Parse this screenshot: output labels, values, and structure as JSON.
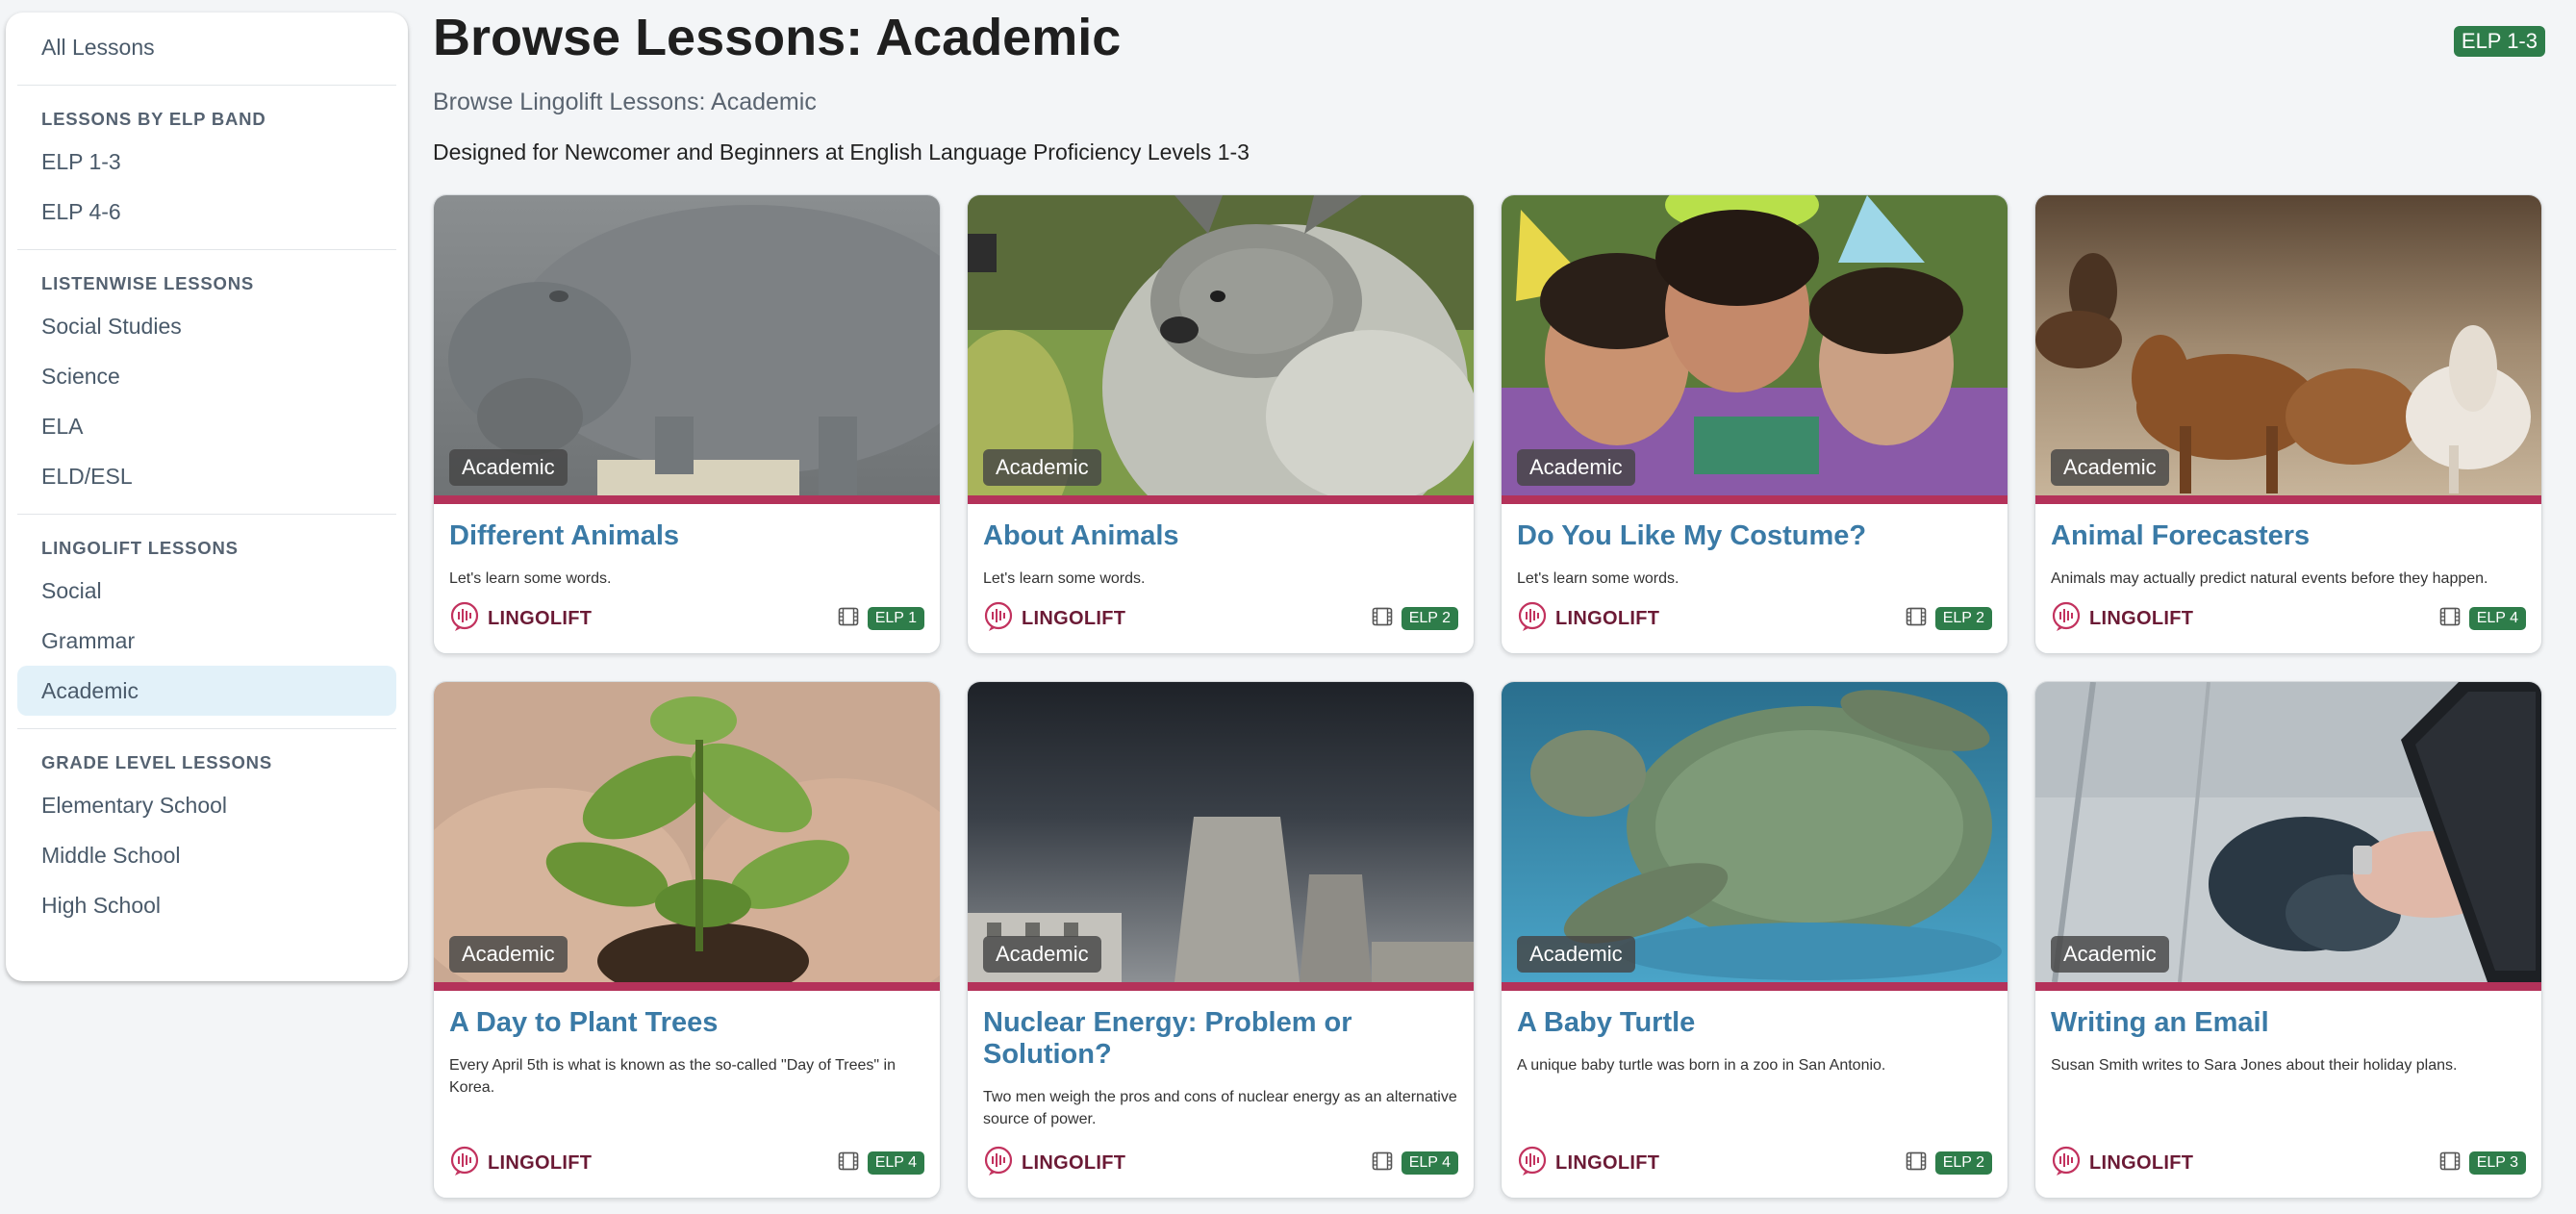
{
  "sidebar": {
    "all_lessons": "All Lessons",
    "sections": [
      {
        "heading": "LESSONS BY ELP BAND",
        "items": [
          "ELP 1-3",
          "ELP 4-6"
        ]
      },
      {
        "heading": "LISTENWISE LESSONS",
        "items": [
          "Social Studies",
          "Science",
          "ELA",
          "ELD/ESL"
        ]
      },
      {
        "heading": "LINGOLIFT LESSONS",
        "items": [
          "Social",
          "Grammar",
          "Academic"
        ]
      },
      {
        "heading": "GRADE LEVEL LESSONS",
        "items": [
          "Elementary School",
          "Middle School",
          "High School"
        ]
      }
    ],
    "active_item": "Academic"
  },
  "header": {
    "title": "Browse Lessons: Academic",
    "elp_badge": "ELP 1-3",
    "subtitle": "Browse Lingolift Lessons: Academic",
    "description": "Designed for Newcomer and Beginners at English Language Proficiency Levels 1-3"
  },
  "colors": {
    "accent_bar": "#b4325a",
    "title_link": "#3a7aa6",
    "elp_green": "#2e7d4a",
    "brand": "#6b1a35",
    "active_sidebar": "#e2f1f9"
  },
  "cards": [
    {
      "category": "Academic",
      "title": "Different Animals",
      "text": "Let's learn some words.",
      "brand": "LINGOLIFT",
      "elp": "ELP 1",
      "image": "hippo"
    },
    {
      "category": "Academic",
      "title": "About Animals",
      "text": "Let's learn some words.",
      "brand": "LINGOLIFT",
      "elp": "ELP 2",
      "image": "kangaroo"
    },
    {
      "category": "Academic",
      "title": "Do You Like My Costume?",
      "text": "Let's learn some words.",
      "brand": "LINGOLIFT",
      "elp": "ELP 2",
      "image": "party-kids"
    },
    {
      "category": "Academic",
      "title": "Animal Forecasters",
      "text": "Animals may actually predict natural events before they happen.",
      "brand": "LINGOLIFT",
      "elp": "ELP 4",
      "image": "horses"
    },
    {
      "category": "Academic",
      "title": "A Day to Plant Trees",
      "text": "Every April 5th is what is known as the so-called \"Day of Trees\" in Korea.",
      "brand": "LINGOLIFT",
      "elp": "ELP 4",
      "image": "seedling"
    },
    {
      "category": "Academic",
      "title": "Nuclear Energy: Problem or Solution?",
      "text": "Two men weigh the pros and cons of nuclear energy as an alternative source of power.",
      "brand": "LINGOLIFT",
      "elp": "ELP 4",
      "image": "cooling-tower"
    },
    {
      "category": "Academic",
      "title": "A Baby Turtle",
      "text": "A unique baby turtle was born in a zoo in San Antonio.",
      "brand": "LINGOLIFT",
      "elp": "ELP 2",
      "image": "turtle"
    },
    {
      "category": "Academic",
      "title": "Writing an Email",
      "text": "Susan Smith writes to Sara Jones about their holiday plans.",
      "brand": "LINGOLIFT",
      "elp": "ELP 3",
      "image": "phone-hand"
    }
  ]
}
